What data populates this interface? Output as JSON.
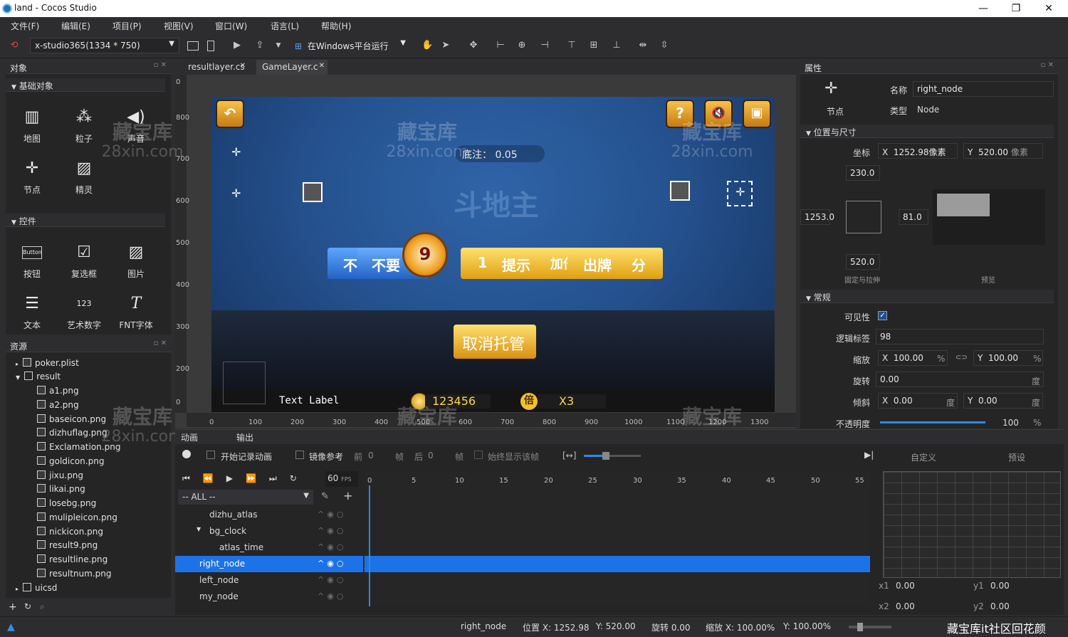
{
  "window": {
    "title": "land - Cocos Studio",
    "min": "—",
    "max": "❐",
    "close": "✕"
  },
  "menu": [
    "文件(F)",
    "编辑(E)",
    "项目(P)",
    "视图(V)",
    "窗口(W)",
    "语言(L)",
    "帮助(H)"
  ],
  "toolbar": {
    "resolution": "x-studio365(1334 * 750)",
    "run_target": "在Windows平台运行"
  },
  "objects_panel": {
    "title": "对象",
    "basic_section": "基础对象",
    "basic_items": [
      "地图",
      "粒子",
      "声音",
      "节点",
      "精灵"
    ],
    "controls_section": "控件",
    "control_items": [
      "按钮",
      "复选框",
      "图片",
      "文本",
      "艺术数字",
      "FNT字体"
    ],
    "button_icon_text": "Button",
    "label_icon_text": "123"
  },
  "resources_panel": {
    "title": "资源",
    "items": [
      "poker.plist",
      "result",
      "a1.png",
      "a2.png",
      "baseicon.png",
      "dizhuflag.png",
      "Exclamation.png",
      "goldicon.png",
      "jixu.png",
      "likai.png",
      "losebg.png",
      "mulipleicon.png",
      "nickicon.png",
      "result9.png",
      "resultline.png",
      "resultnum.png",
      "uicsd"
    ]
  },
  "tabs": [
    "resultlayer.cs",
    "GameLayer.c"
  ],
  "stage": {
    "bet_label": "底注：  0.05",
    "logo_text": "斗地主",
    "buttons": [
      "不",
      "不要",
      "倍",
      "1",
      "提示",
      "加倍",
      "出牌",
      "分"
    ],
    "clock_number": "9",
    "cancel_auto": "取消托管",
    "text_label": "Text Label",
    "coins": "123456",
    "multiplier_icon": "倍",
    "multiplier": "X3",
    "help": "?",
    "sound": "🔇",
    "robot": "▣",
    "back": "↶"
  },
  "ruler_v": [
    "800",
    "700",
    "600",
    "500",
    "400",
    "300",
    "200",
    "100",
    "0"
  ],
  "ruler_h": [
    "0",
    "100",
    "200",
    "300",
    "400",
    "500",
    "600",
    "700",
    "800",
    "900",
    "1000",
    "1100",
    "1200",
    "1300"
  ],
  "watermark": {
    "line1": "藏宝库",
    "line2": "28xin.com"
  },
  "properties": {
    "title": "属性",
    "node_label": "节点",
    "name_label": "名称",
    "name_value": "right_node",
    "type_label": "类型",
    "type_value": "Node",
    "pos_section": "位置与尺寸",
    "coord_label": "坐标",
    "x_label": "X",
    "x_value": "1252.98像素",
    "y_label": "Y",
    "y_value": "520.00",
    "y_unit": "像素",
    "top": "230.0",
    "left": "1253.0",
    "right": "81.0",
    "bottom": "520.0",
    "anchor_caption": "固定与拉伸",
    "preview_caption": "预览",
    "general_section": "常规",
    "visible_label": "可见性",
    "tag_label": "逻辑标签",
    "tag_value": "98",
    "scale_label": "缩放",
    "scale_x": "100.00",
    "scale_y": "100.00",
    "percent": "%",
    "rotate_label": "旋转",
    "rotate_value": "0.00",
    "degree": "度",
    "skew_label": "倾斜",
    "skew_x": "0.00",
    "skew_y": "0.00",
    "opacity_label": "不透明度",
    "opacity_value": "100",
    "opacity_level": 1.0
  },
  "animation": {
    "tab": "动画",
    "output_tab": "输出",
    "record": "开始记录动画",
    "mirror": "镜像参考",
    "prev": "前",
    "prev_val": "0",
    "frame": "帧",
    "next": "后",
    "next_val": "0",
    "always_show": "始终显示该帧",
    "fps": "60",
    "fps_unit": "FPS",
    "filter": "-- ALL --",
    "ticks": [
      "0",
      "5",
      "10",
      "15",
      "20",
      "25",
      "30",
      "35",
      "40",
      "45",
      "50",
      "55"
    ],
    "rows": [
      "dizhu_atlas",
      "bg_clock",
      "atlas_time",
      "right_node",
      "left_node",
      "my_node"
    ],
    "selected_row": "right_node",
    "curve_tabs": [
      "自定义",
      "预设"
    ],
    "x1": "x1",
    "x1_val": "0.00",
    "y1": "y1",
    "y1_val": "0.00",
    "x2": "x2",
    "x2_val": "0.00",
    "y2": "y2",
    "y2_val": "0.00"
  },
  "statusbar": {
    "node": "right_node",
    "pos": "位置 X: 1252.98",
    "pos_y": "Y: 520.00",
    "rot": "旋转 0.00",
    "scale": "缩放 X: 100.00%",
    "scale_y": "Y: 100.00%",
    "community": "藏宝库it社区回花颜"
  }
}
